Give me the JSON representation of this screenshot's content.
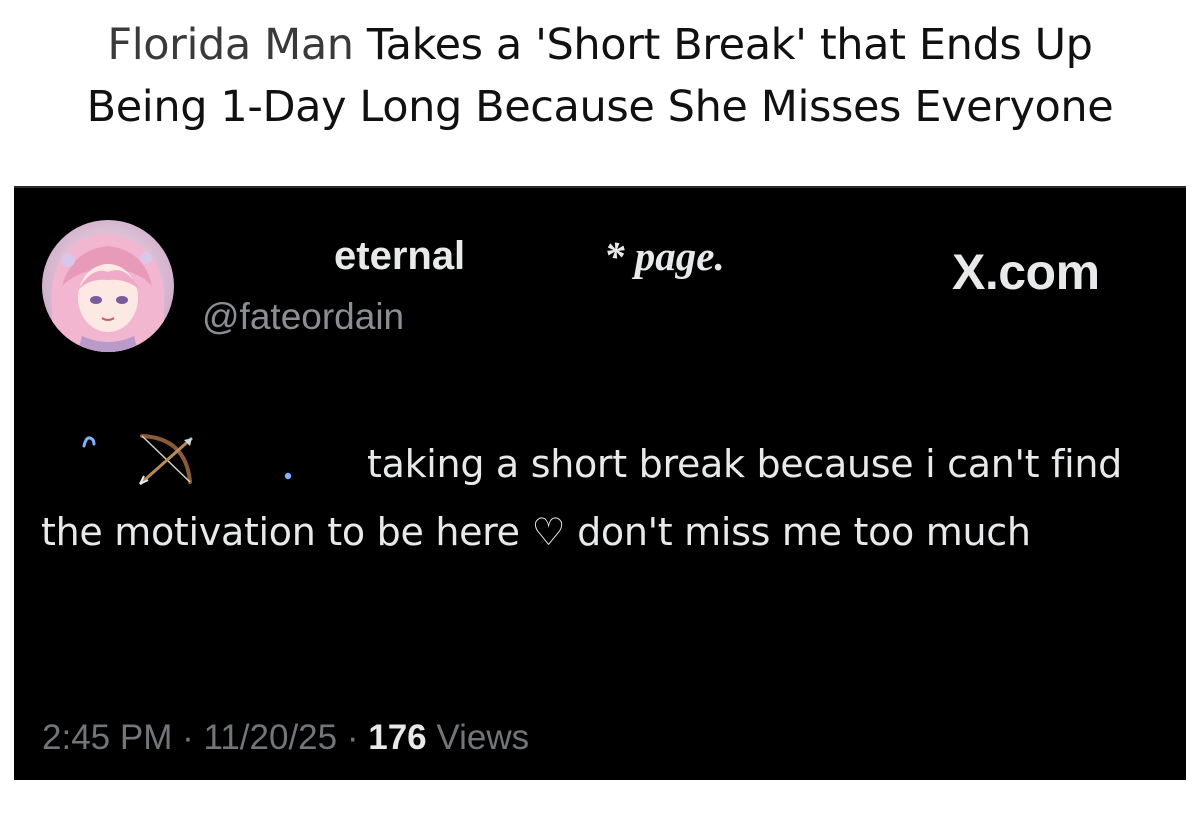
{
  "headline": {
    "kicker": "Florida Man",
    "text_line1": "Takes a 'Short Break' that Ends Up",
    "text_line2": "Being 1-Day Long Because She Misses Everyone"
  },
  "tweet": {
    "display_name": "eternal",
    "name_tag": "* page.",
    "site": "X.com",
    "handle": "@fateordain",
    "decor_icons": [
      "sparkle-icon",
      "bow-and-arrow-icon",
      "dot-icon"
    ],
    "body": "taking a short break because i can't find the motivation to be here ♡ don't miss me too much",
    "time": "2:45 PM",
    "separator": " · ",
    "date": "11/20/25",
    "views_count": "176",
    "views_label": "Views"
  },
  "colors": {
    "card_background": "#000000",
    "primary_text": "#e7e9ea",
    "secondary_text": "#71767b",
    "avatar_pink": "#f3b6d0"
  }
}
